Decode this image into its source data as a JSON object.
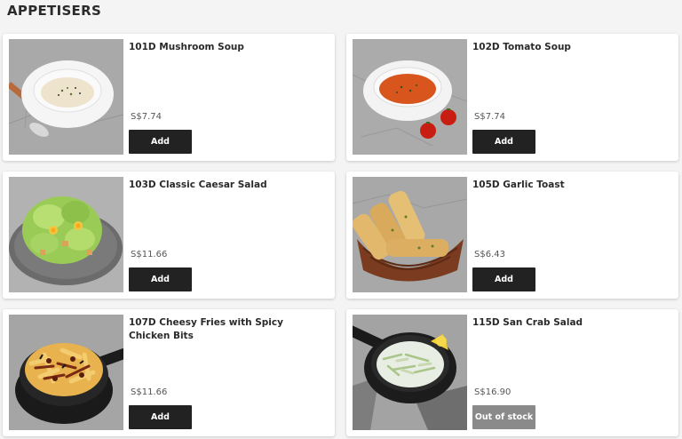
{
  "section": {
    "title": "APPETISERS"
  },
  "items": [
    {
      "name": "101D Mushroom Soup",
      "price": "S$7.74",
      "button": "Add",
      "available": true
    },
    {
      "name": "102D Tomato Soup",
      "price": "S$7.74",
      "button": "Add",
      "available": true
    },
    {
      "name": "103D Classic Caesar Salad",
      "price": "S$11.66",
      "button": "Add",
      "available": true
    },
    {
      "name": "105D Garlic Toast",
      "price": "S$6.43",
      "button": "Add",
      "available": true
    },
    {
      "name": "107D Cheesy Fries with Spicy Chicken Bits",
      "price": "S$11.66",
      "button": "Add",
      "available": true
    },
    {
      "name": "115D San Crab Salad",
      "price": "S$16.90",
      "button": "Out of stock",
      "available": false
    }
  ],
  "colors": {
    "button_bg": "#222222",
    "button_disabled_bg": "#8a8a8a",
    "card_bg": "#ffffff",
    "page_bg": "#f4f4f4"
  }
}
